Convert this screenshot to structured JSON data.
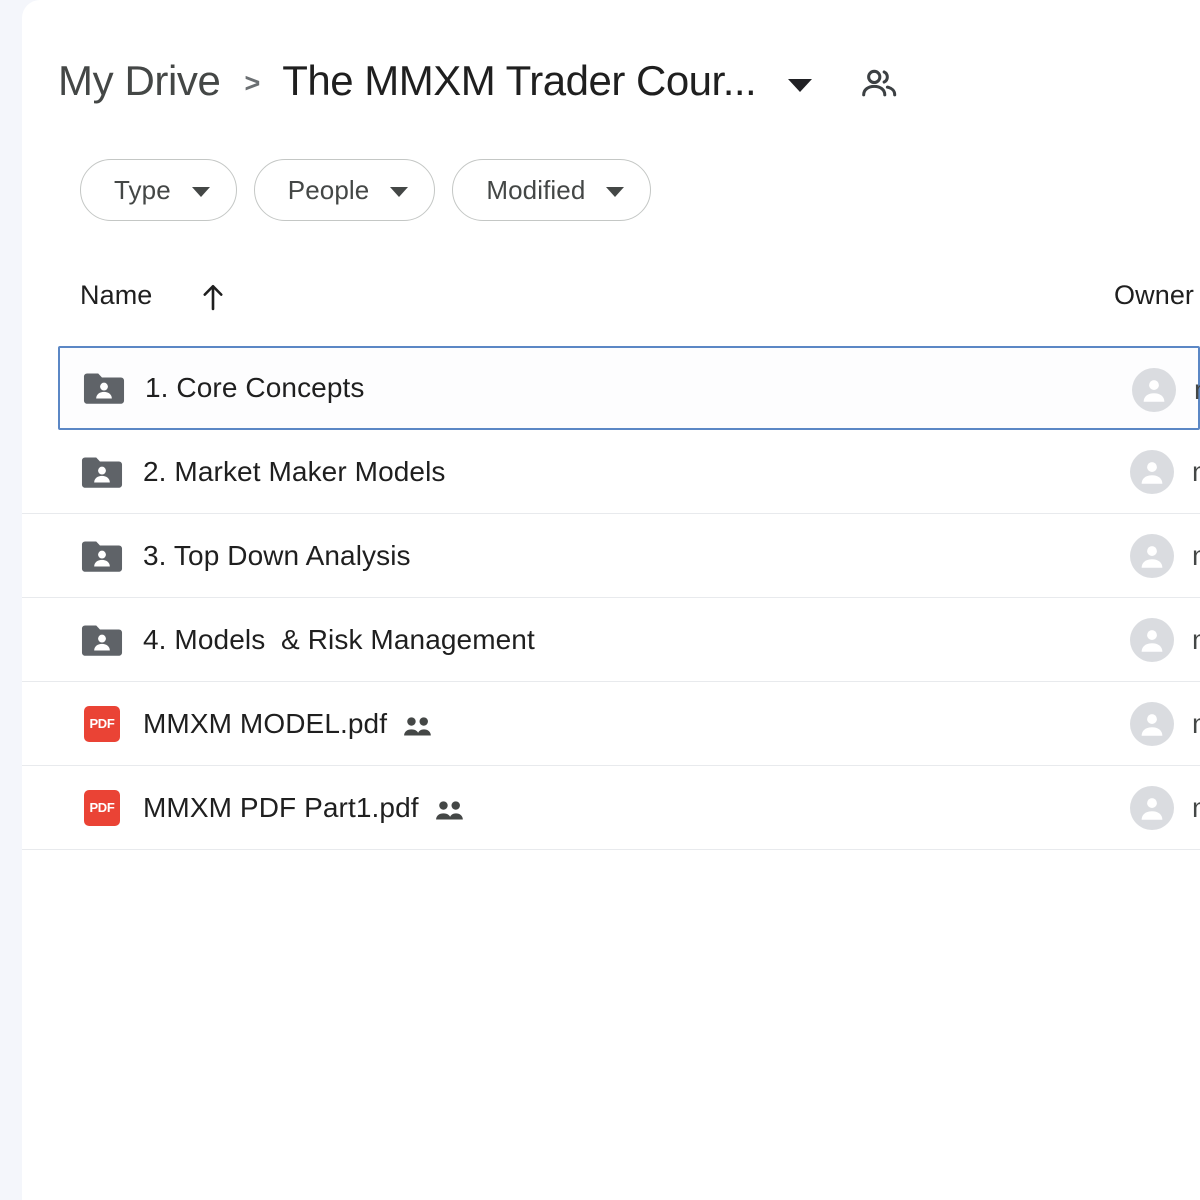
{
  "theme": {
    "page_background": "#f4f6fb",
    "panel_background": "#ffffff",
    "selection_border": "#5b87c5",
    "pdf_red": "#ea4335",
    "folder_gray": "#5f6368",
    "divider": "#e8eaed",
    "text_primary": "#1f1f1f",
    "text_secondary": "#444746"
  },
  "breadcrumb": {
    "root": "My Drive",
    "separator": ">",
    "current": "The MMXM Trader Cour...",
    "caret_icon": "chevron-down-icon",
    "share_icon": "people-shared-icon"
  },
  "filters": [
    {
      "label": "Type",
      "caret_icon": "chevron-down-icon"
    },
    {
      "label": "People",
      "caret_icon": "chevron-down-icon"
    },
    {
      "label": "Modified",
      "caret_icon": "chevron-down-icon"
    }
  ],
  "list_header": {
    "name_column": "Name",
    "sort_icon": "arrow-up-icon",
    "sort_direction": "ascending",
    "owner_column": "Owner"
  },
  "rows": [
    {
      "name": "1. Core Concepts",
      "icon": "shared-folder-icon",
      "type": "folder",
      "shared_badge": false,
      "selected": true,
      "owner": "me"
    },
    {
      "name": "2. Market Maker Models",
      "icon": "shared-folder-icon",
      "type": "folder",
      "shared_badge": false,
      "selected": false,
      "owner": "me"
    },
    {
      "name": "3. Top Down Analysis",
      "icon": "shared-folder-icon",
      "type": "folder",
      "shared_badge": false,
      "selected": false,
      "owner": "me"
    },
    {
      "name": "4. Models  & Risk Management",
      "icon": "shared-folder-icon",
      "type": "folder",
      "shared_badge": false,
      "selected": false,
      "owner": "me"
    },
    {
      "name": "MMXM MODEL.pdf",
      "icon": "pdf-file-icon",
      "type": "pdf",
      "icon_text": "PDF",
      "shared_badge": true,
      "shared_badge_icon": "people-filled-icon",
      "selected": false,
      "owner": "me"
    },
    {
      "name": "MMXM PDF Part1.pdf",
      "icon": "pdf-file-icon",
      "type": "pdf",
      "icon_text": "PDF",
      "shared_badge": true,
      "shared_badge_icon": "people-filled-icon",
      "selected": false,
      "owner": "me"
    }
  ]
}
